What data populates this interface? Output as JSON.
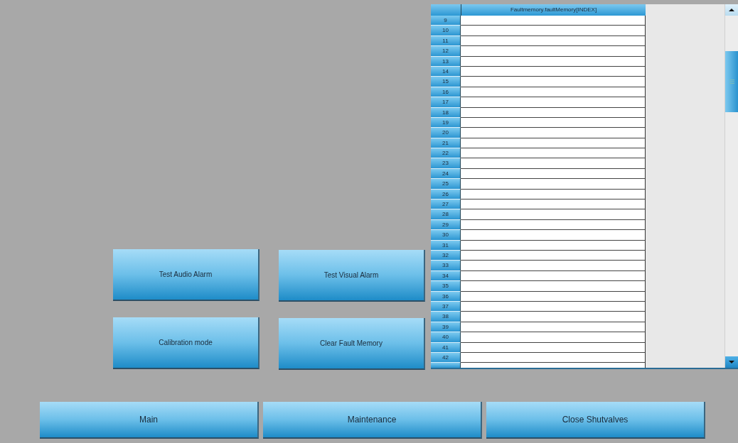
{
  "actions": [
    "Test Audio Alarm",
    "Test Visual Alarm",
    "Calibration mode",
    "Clear Fault Memory"
  ],
  "table": {
    "columns": [
      "Faultmemory.faultMemory[INDEX]"
    ],
    "row_headers": [
      "9",
      "10",
      "11",
      "12",
      "13",
      "14",
      "15",
      "16",
      "17",
      "18",
      "19",
      "20",
      "21",
      "22",
      "23",
      "24",
      "25",
      "26",
      "27",
      "28",
      "29",
      "30",
      "31",
      "32",
      "33",
      "34",
      "35",
      "36",
      "37",
      "38",
      "39",
      "40",
      "41",
      "42"
    ]
  },
  "nav_buttons": [
    "Main",
    "Maintenance",
    "Close Shutvalves"
  ]
}
